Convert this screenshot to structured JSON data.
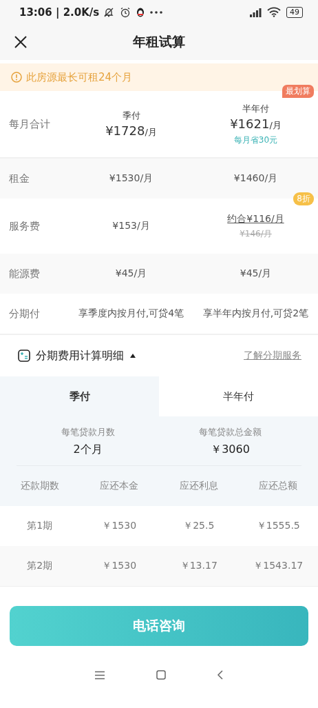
{
  "status_bar": {
    "time_speed": "13:06 | 2.0K/s",
    "battery": "49"
  },
  "header": {
    "title": "年租试算"
  },
  "notice": {
    "text": "此房源最长可租24个月"
  },
  "plans_row": {
    "label": "每月合计",
    "plans": [
      {
        "name": "季付",
        "price": "¥1728",
        "unit": "/月"
      },
      {
        "name": "半年付",
        "price": "¥1621",
        "unit": "/月",
        "saving": "每月省30元",
        "badge": "最划算"
      }
    ]
  },
  "fee_rows": [
    {
      "label": "租金",
      "values": [
        {
          "text": "¥1530/月",
          "underlined": false
        },
        {
          "text": "¥1460/月",
          "underlined": false
        }
      ]
    },
    {
      "label": "服务费",
      "values": [
        {
          "text": "¥153/月",
          "underlined": false
        },
        {
          "text": "约合¥116/月",
          "underlined": true,
          "original": "¥146/月",
          "badge": "8折"
        }
      ]
    },
    {
      "label": "能源费",
      "values": [
        {
          "text": "¥45/月",
          "underlined": false
        },
        {
          "text": "¥45/月",
          "underlined": false
        }
      ]
    },
    {
      "label": "分期付",
      "values": [
        {
          "text": "享季度内按月付,可贷4笔",
          "underlined": false
        },
        {
          "text": "享半年内按月付,可贷2笔",
          "underlined": false
        }
      ]
    }
  ],
  "details": {
    "title": "分期费用计算明细",
    "expanded": true,
    "link": "了解分期服务",
    "tabs": [
      {
        "label": "季付",
        "selected": true
      },
      {
        "label": "半年付",
        "selected": false
      }
    ],
    "summary": [
      {
        "label": "每笔贷款月数",
        "value": "2个月"
      },
      {
        "label": "每笔贷款总金额",
        "value": "￥3060"
      }
    ],
    "table": {
      "columns": [
        "还款期数",
        "应还本金",
        "应还利息",
        "应还总额"
      ],
      "rows": [
        [
          "第1期",
          "￥1530",
          "￥25.5",
          "￥1555.5"
        ],
        [
          "第2期",
          "￥1530",
          "￥13.17",
          "￥1543.17"
        ]
      ]
    }
  },
  "action_button": {
    "label": "电话咨询"
  }
}
